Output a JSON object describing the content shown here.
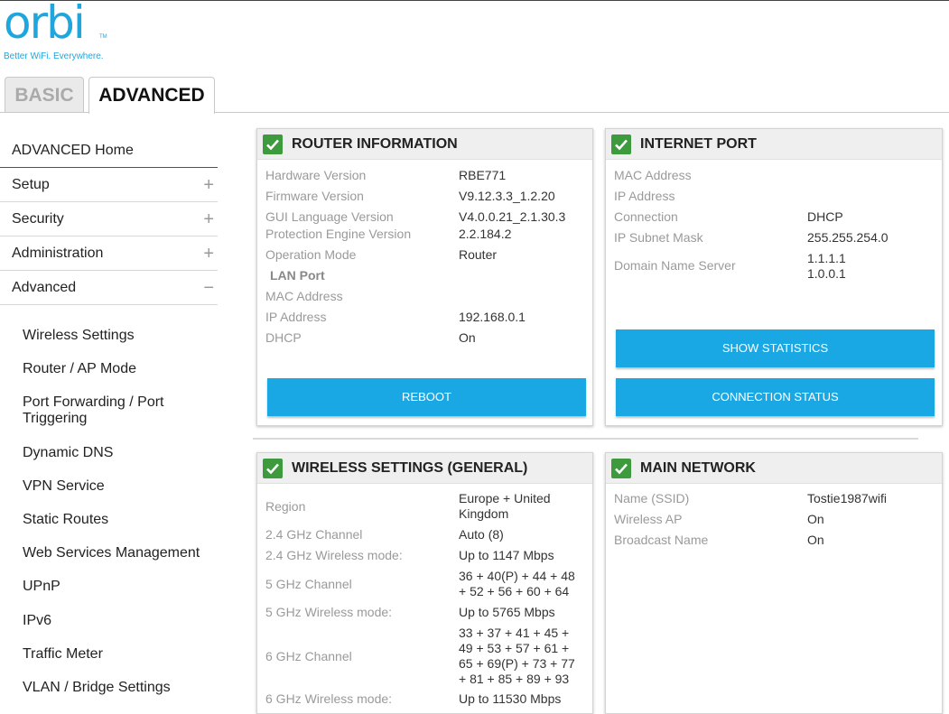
{
  "logo": {
    "word": "orbi",
    "tm": "TM",
    "tagline": "Better WiFi. Everywhere."
  },
  "tabs": {
    "basic": "BASIC",
    "advanced": "ADVANCED"
  },
  "sidebar": {
    "home": "ADVANCED Home",
    "sections": [
      {
        "label": "Setup",
        "sign": "+"
      },
      {
        "label": "Security",
        "sign": "+"
      },
      {
        "label": "Administration",
        "sign": "+"
      },
      {
        "label": "Advanced",
        "sign": "−"
      }
    ],
    "advanced_items": [
      "Wireless Settings",
      "Router / AP Mode",
      "Port Forwarding / Port Triggering",
      "Dynamic DNS",
      "VPN Service",
      "Static Routes",
      "Web Services Management",
      "UPnP",
      "IPv6",
      "Traffic Meter",
      "VLAN / Bridge Settings"
    ]
  },
  "router_info": {
    "title": "ROUTER INFORMATION",
    "rows": [
      {
        "label": "Hardware Version",
        "value": "RBE771"
      },
      {
        "label": "Firmware Version",
        "value": "V9.12.3.3_1.2.20"
      },
      {
        "label": "GUI Language Version",
        "value": "V4.0.0.21_2.1.30.3"
      },
      {
        "label": "Protection Engine Version",
        "value": "2.2.184.2"
      },
      {
        "label": "Operation Mode",
        "value": "Router"
      },
      {
        "label": "LAN Port",
        "value": ""
      },
      {
        "label": "MAC Address",
        "value": ""
      },
      {
        "label": "IP Address",
        "value": "192.168.0.1"
      },
      {
        "label": "DHCP",
        "value": "On"
      }
    ],
    "reboot_label": "REBOOT"
  },
  "internet_port": {
    "title": "INTERNET PORT",
    "rows": [
      {
        "label": "MAC Address",
        "value": ""
      },
      {
        "label": "IP Address",
        "value": ""
      },
      {
        "label": "Connection",
        "value": "DHCP"
      },
      {
        "label": "IP Subnet Mask",
        "value": "255.255.254.0"
      },
      {
        "label": "Domain Name Server",
        "value": "1.1.1.1\n1.0.0.1"
      }
    ],
    "show_statistics_label": "SHOW STATISTICS",
    "connection_status_label": "CONNECTION STATUS"
  },
  "wireless_general": {
    "title": "WIRELESS SETTINGS (GENERAL)",
    "rows": [
      {
        "label": "Region",
        "value": "Europe + United Kingdom"
      },
      {
        "label": "2.4 GHz Channel",
        "value": "Auto (8)"
      },
      {
        "label": "2.4 GHz Wireless mode:",
        "value": "Up to 1147 Mbps"
      },
      {
        "label": "5 GHz Channel",
        "value": "36 + 40(P) + 44 + 48 + 52 + 56 + 60 + 64"
      },
      {
        "label": "5 GHz Wireless mode:",
        "value": "Up to 5765 Mbps"
      },
      {
        "label": "6 GHz Channel",
        "value": "33 + 37 + 41 + 45 + 49 + 53 + 57 + 61 + 65 + 69(P) + 73 + 77 + 81 + 85 + 89 + 93"
      },
      {
        "label": "6 GHz Wireless mode:",
        "value": "Up to 11530 Mbps"
      }
    ]
  },
  "main_network": {
    "title": "MAIN NETWORK",
    "rows": [
      {
        "label": "Name (SSID)",
        "value": "Tostie1987wifi"
      },
      {
        "label": "Wireless AP",
        "value": "On"
      },
      {
        "label": "Broadcast Name",
        "value": "On"
      }
    ]
  },
  "colors": {
    "accent": "#1aa8e4",
    "check_green": "#3d9a3d",
    "logo_blue": "#1fa6dd"
  }
}
